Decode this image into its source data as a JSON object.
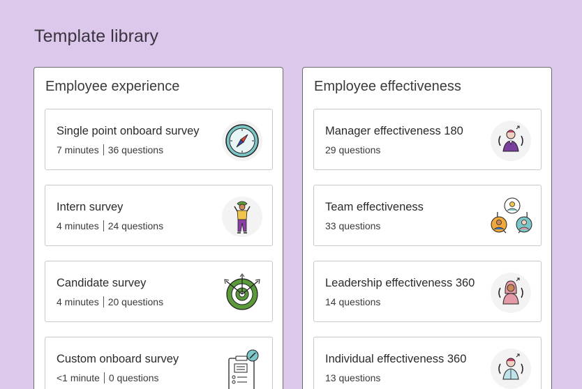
{
  "page_title": "Template library",
  "panels": [
    {
      "title": "Employee experience",
      "cards": [
        {
          "title": "Single point onboard survey",
          "minutes": "7 minutes",
          "questions": "36 questions",
          "icon": "compass-icon"
        },
        {
          "title": "Intern survey",
          "minutes": "4 minutes",
          "questions": "24 questions",
          "icon": "intern-person-icon"
        },
        {
          "title": "Candidate survey",
          "minutes": "4 minutes",
          "questions": "20 questions",
          "icon": "target-arrows-icon"
        },
        {
          "title": "Custom onboard survey",
          "minutes": "<1 minute",
          "questions": "0 questions",
          "icon": "clipboard-icon"
        }
      ]
    },
    {
      "title": "Employee effectiveness",
      "cards": [
        {
          "title": "Manager effectiveness 180",
          "questions": "29 questions",
          "icon": "manager-person-icon"
        },
        {
          "title": "Team effectiveness",
          "questions": "33 questions",
          "icon": "team-circle-icon"
        },
        {
          "title": "Leadership effectiveness 360",
          "questions": "14 questions",
          "icon": "leader-person-icon"
        },
        {
          "title": "Individual effectiveness 360",
          "questions": "13 questions",
          "icon": "individual-person-icon"
        }
      ]
    }
  ],
  "colors": {
    "background": "#dcc8ea",
    "purple": "#7a3e9d",
    "teal": "#7cc6c8",
    "green": "#5a9a3a",
    "pink": "#e59aa8"
  }
}
